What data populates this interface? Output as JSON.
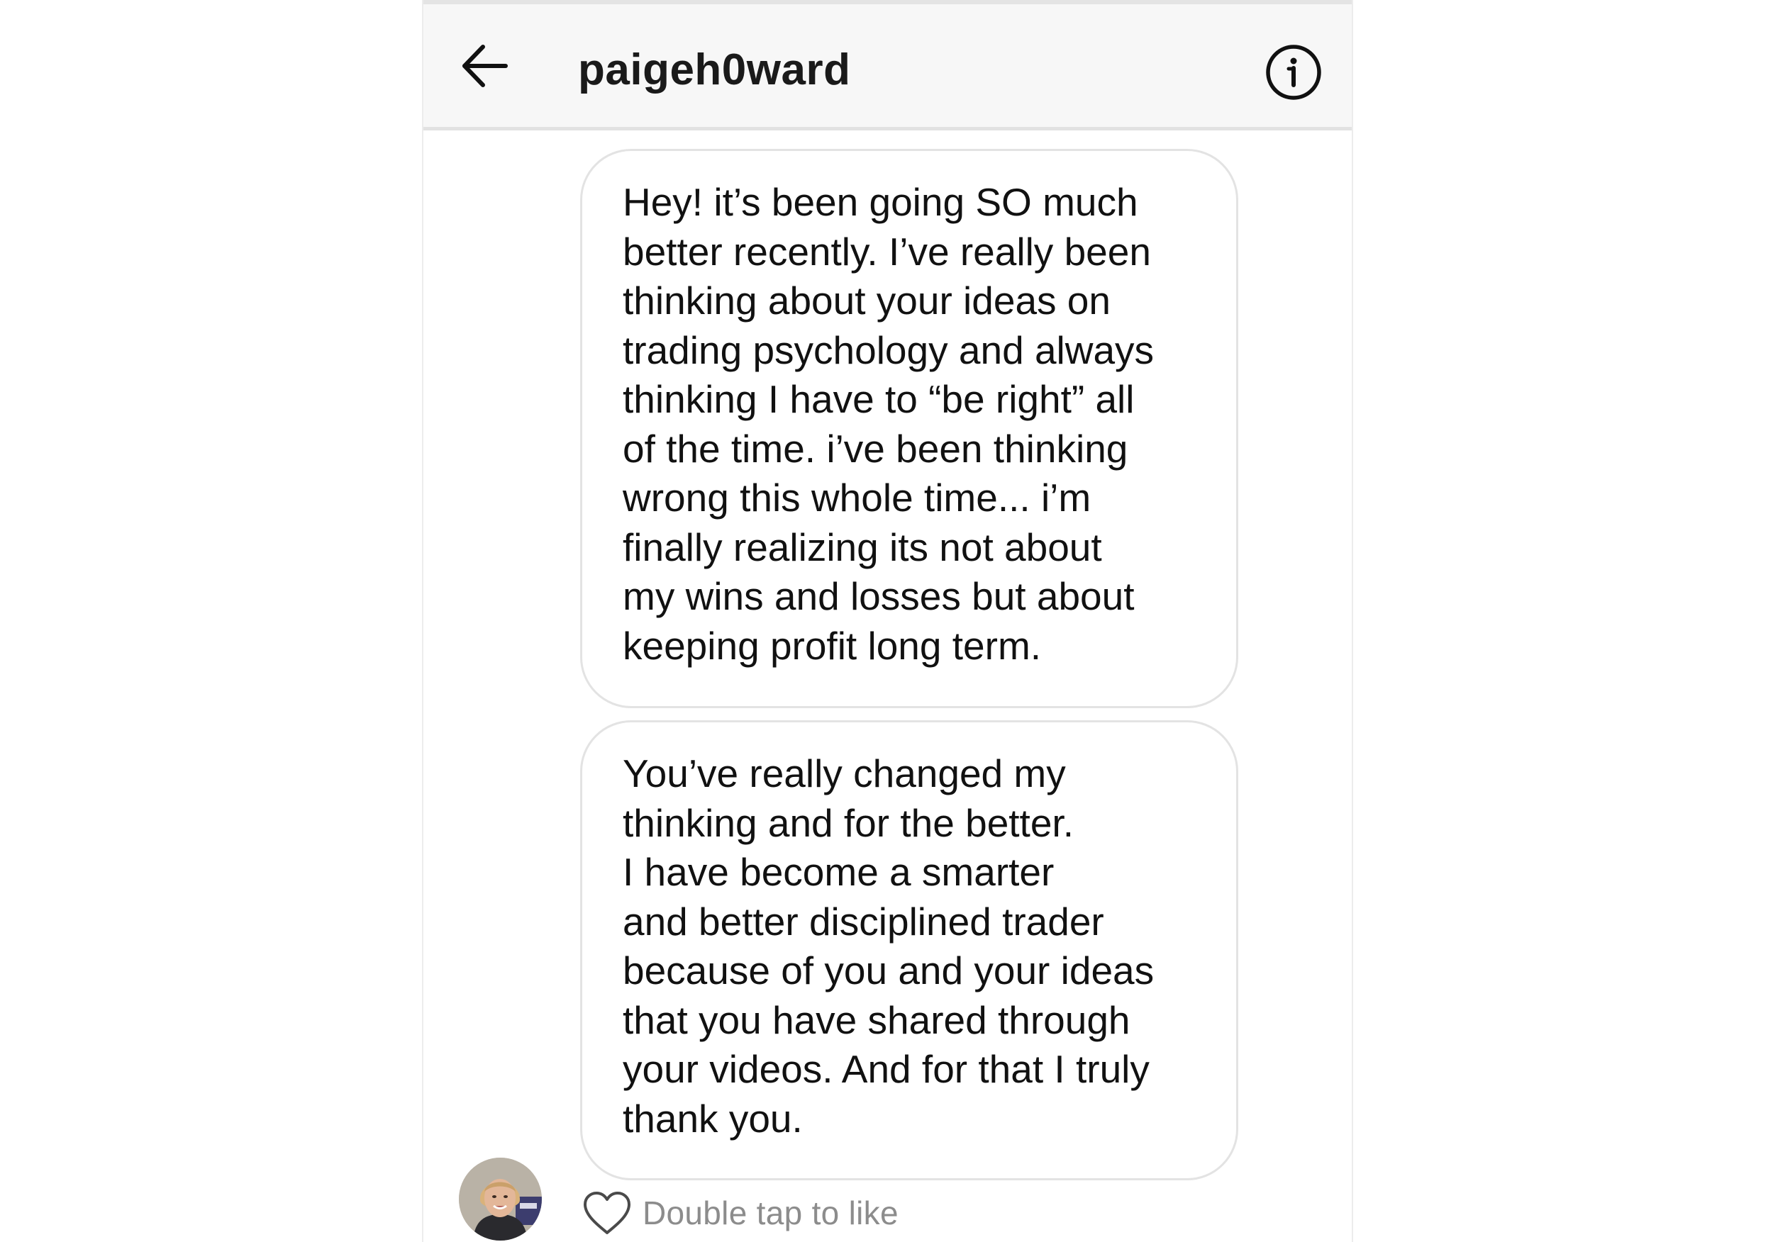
{
  "header": {
    "title": "paigeh0ward",
    "back_icon": "arrow-left-icon",
    "info_icon": "info-circle-icon"
  },
  "messages": [
    {
      "text": "Hey! it’s been going SO much\nbetter recently. I’ve really been\nthinking about your ideas on\ntrading psychology and always\nthinking I have to “be right” all\nof the time. i’ve been thinking\nwrong this whole time... i’m\nfinally realizing its not about\nmy wins and losses but about\nkeeping profit long term."
    },
    {
      "text": "You’ve really changed my\nthinking and for the better.\nI have become a smarter\nand better disciplined trader\nbecause of you and your ideas\nthat you have shared through\nyour videos. And for that I truly\nthank you."
    }
  ],
  "footer": {
    "like_hint": "Double tap to like",
    "heart_icon": "heart-outline-icon"
  },
  "colors": {
    "header_bg": "#f7f7f7",
    "bubble_border": "#e3e3e3",
    "text": "#111111",
    "muted_text": "#8c8c8c"
  }
}
